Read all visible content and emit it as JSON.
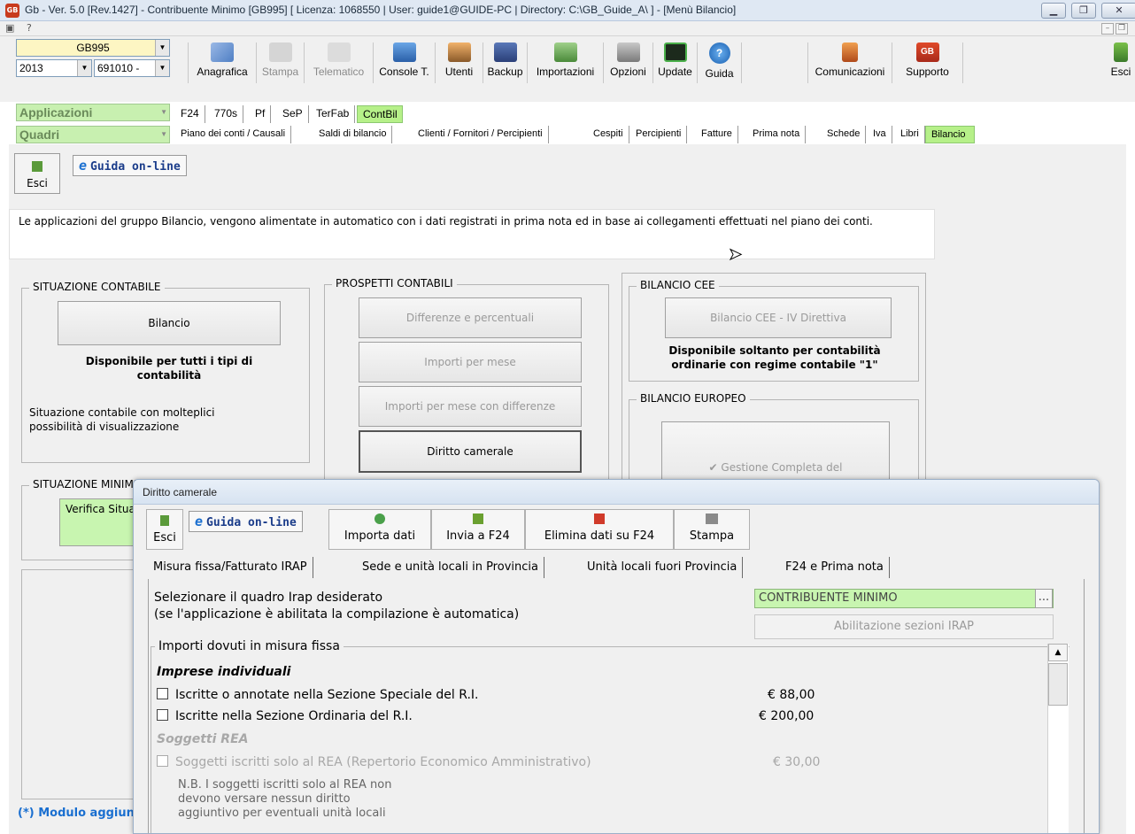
{
  "window": {
    "title": "Gb - Ver. 5.0 [Rev.1427] - Contribuente Minimo [GB995]    [ Licenza: 1068550 | User: guide1@GUIDE-PC | Directory: C:\\GB_Guide_A\\ ] - [Menù Bilancio]",
    "logo_text": "GB",
    "menu_label": "?"
  },
  "toolbar": {
    "client_code": "GB995",
    "year": "2013",
    "code": "691010 -",
    "applicazioni_label": "Applicazioni",
    "quadri_label": "Quadri",
    "buttons": [
      {
        "label": "Anagrafica",
        "icon": "card-icon",
        "enabled": true
      },
      {
        "label": "Stampa",
        "icon": "printer-icon",
        "enabled": false
      },
      {
        "label": "Telematico",
        "icon": "telematic-icon",
        "enabled": false
      },
      {
        "label": "Console T.",
        "icon": "console-icon",
        "enabled": true
      },
      {
        "label": "Utenti",
        "icon": "users-icon",
        "enabled": true
      },
      {
        "label": "Backup",
        "icon": "backup-icon",
        "enabled": true
      },
      {
        "label": "Importazioni",
        "icon": "import-icon",
        "enabled": true
      },
      {
        "label": "Opzioni",
        "icon": "options-icon",
        "enabled": true
      },
      {
        "label": "Update",
        "icon": "update-icon",
        "enabled": true
      },
      {
        "label": "Guida",
        "icon": "help-icon",
        "enabled": true
      }
    ],
    "right_buttons": [
      {
        "label": "Comunicazioni",
        "icon": "communications-icon"
      },
      {
        "label": "Supporto",
        "icon": "support-icon"
      }
    ],
    "exit_label": "Esci"
  },
  "app_tabs": [
    "F24",
    "770s",
    "Pf",
    "SeP",
    "TerFab",
    "ContBil"
  ],
  "quadri_tabs": [
    "Piano dei conti / Causali",
    "Saldi di bilancio",
    "Clienti / Fornitori / Percipienti",
    "Cespiti",
    "Percipienti",
    "Fatture",
    "Prima nota",
    "Schede",
    "Iva",
    "Libri",
    "Bilancio"
  ],
  "main": {
    "exit_label": "Esci",
    "guide_label": "Guida on-line",
    "intro": "Le applicazioni del gruppo Bilancio, vengono alimentate in automatico con i dati registrati in prima nota ed in base ai collegamenti effettuati nel piano dei conti.",
    "situazione_contabile": {
      "title": "SITUAZIONE CONTABILE",
      "button": "Bilancio",
      "note": "Disponibile per tutti i tipi di contabilità",
      "description": "Situazione contabile con molteplici possibilità di visualizzazione"
    },
    "situazione_minimi": {
      "title": "SITUAZIONE MINIMI",
      "button": "Verifica Situazione"
    },
    "prospetti": {
      "title": "PROSPETTI CONTABILI",
      "buttons": [
        "Differenze e percentuali",
        "Importi per mese",
        "Importi per mese con differenze",
        "Diritto camerale"
      ]
    },
    "bilancio_cee": {
      "title": "BILANCIO CEE",
      "button": "Bilancio CEE - IV Direttiva",
      "note": "Disponibile soltanto per contabilità ordinarie con regime contabile \"1\""
    },
    "bilancio_europeo": {
      "title": "BILANCIO EUROPEO",
      "button": "Gestione Completa del"
    },
    "footer_note": "(*) Modulo aggiuntivo"
  },
  "dialog": {
    "title": "Diritto camerale",
    "exit_label": "Esci",
    "guide_label": "Guida on-line",
    "actions": [
      {
        "label": "Importa dati",
        "icon": "import-data-icon"
      },
      {
        "label": "Invia a F24",
        "icon": "send-f24-icon"
      },
      {
        "label": "Elimina dati su F24",
        "icon": "delete-f24-icon"
      },
      {
        "label": "Stampa",
        "icon": "print-icon"
      }
    ],
    "tabs": [
      "Misura fissa/Fatturato IRAP",
      "Sede e unità locali in Provincia",
      "Unità locali fuori Provincia",
      "F24 e Prima nota"
    ],
    "select_label_1": "Selezionare il quadro Irap desiderato",
    "select_label_2": "(se l'applicazione è abilitata la compilazione è automatica)",
    "irap_value": "CONTRIBUENTE MINIMO",
    "browse_label": "...",
    "abilitazione_label": "Abilitazione sezioni IRAP",
    "group_title": "Importi dovuti in misura fissa",
    "imprese_title": "Imprese individuali",
    "rows": [
      {
        "label": "Iscritte o annotate nella Sezione Speciale del R.I.",
        "amount": "€ 88,00",
        "checked": false,
        "enabled": true
      },
      {
        "label": "Iscritte nella Sezione Ordinaria del R.I.",
        "amount": "€ 200,00",
        "checked": false,
        "enabled": true
      }
    ],
    "rea_title": "Soggetti REA",
    "rea_row": {
      "label": "Soggetti iscritti solo al REA (Repertorio Economico Amministrativo)",
      "amount": "€ 30,00",
      "checked": false,
      "enabled": false
    },
    "nb_lines": [
      "N.B. I soggetti iscritti solo al REA non",
      "devono versare nessun diritto",
      "aggiuntivo per eventuali unità locali"
    ]
  },
  "colors": {
    "active_tab": "#b6f089",
    "green_bar": "#c8f0b0",
    "irap_field": "#c8f5b0",
    "link_blue": "#1a6fd0"
  }
}
